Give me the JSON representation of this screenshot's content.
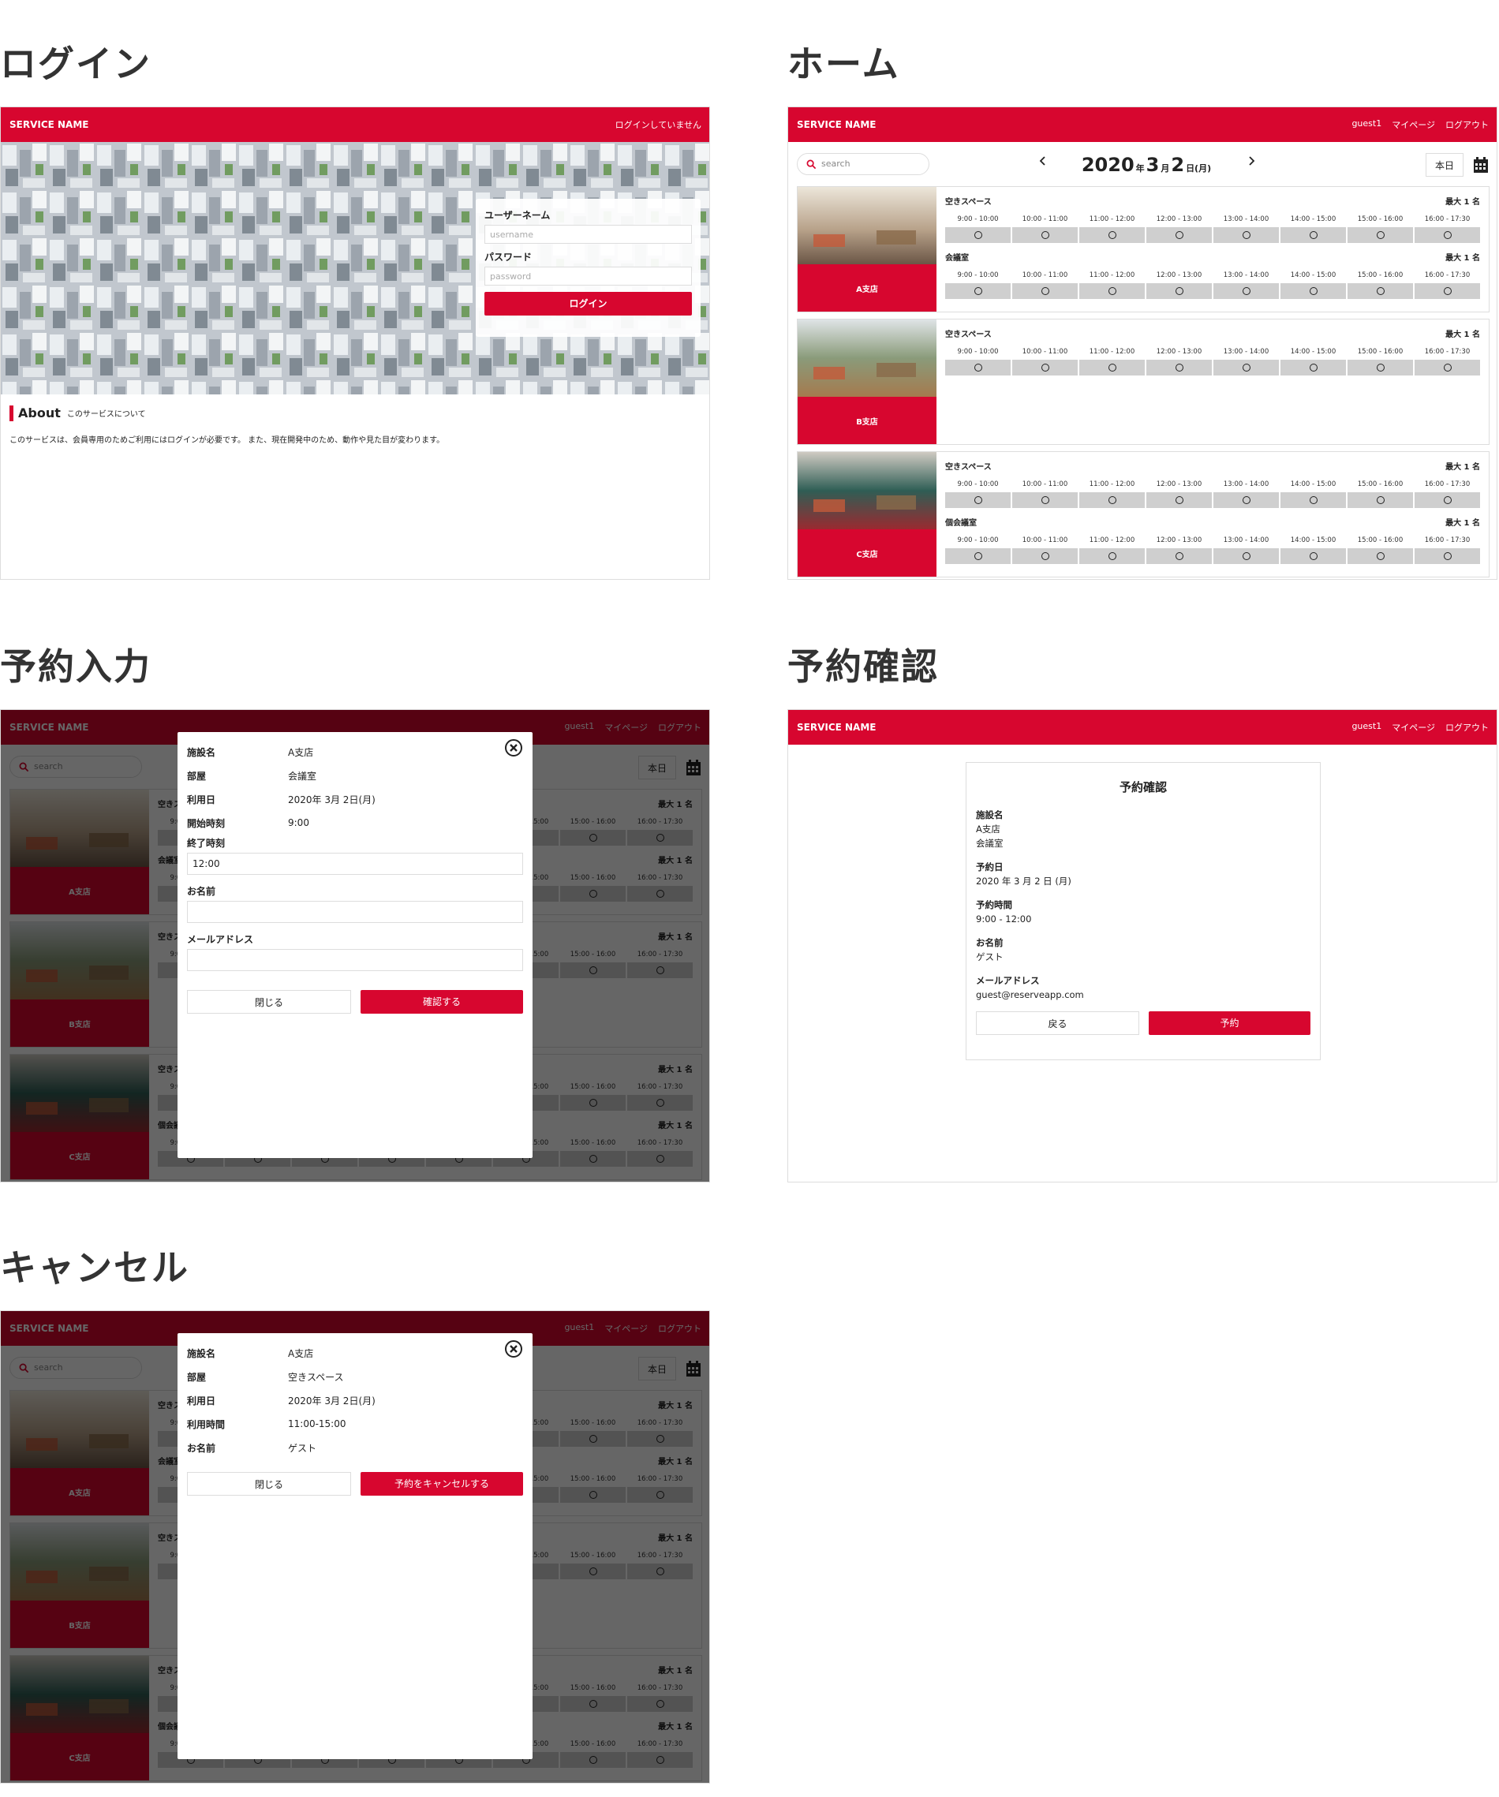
{
  "sections": {
    "login": "ログイン",
    "home": "ホーム",
    "reserve_input": "予約入力",
    "reserve_confirm": "予約確認",
    "cancel": "キャンセル"
  },
  "brand": "SERVICE NAME",
  "header_logged_out": "ログインしていません",
  "header_user": {
    "user": "guest1",
    "mypage": "マイページ",
    "logout": "ログアウト"
  },
  "login": {
    "username_label": "ユーザーネーム",
    "username_placeholder": "username",
    "password_label": "パスワード",
    "password_placeholder": "password",
    "button": "ログイン",
    "about_heading": "About",
    "about_sub": "このサービスについて",
    "about_text": "このサービスは、会員専用のためご利用にはログインが必要です。 また、現在開発中のため、動作や見た目が変わります。"
  },
  "home": {
    "search_placeholder": "search",
    "year": "2020",
    "year_unit": "年",
    "month": "3",
    "month_unit": "月",
    "day": "2",
    "day_unit": "日(月)",
    "today": "本日",
    "slot_times": [
      "9:00 - 10:00",
      "10:00 - 11:00",
      "11:00 - 12:00",
      "12:00 - 13:00",
      "13:00 - 14:00",
      "14:00 - 15:00",
      "15:00 - 16:00",
      "16:00 - 17:30"
    ],
    "available_mark": "○",
    "branches": [
      {
        "name": "A支店",
        "rooms": [
          {
            "name": "空きスペース",
            "cap": "最大 1 名"
          },
          {
            "name": "会議室",
            "cap": "最大 1 名"
          }
        ]
      },
      {
        "name": "B支店",
        "rooms": [
          {
            "name": "空きスペース",
            "cap": "最大 1 名"
          }
        ]
      },
      {
        "name": "C支店",
        "rooms": [
          {
            "name": "空きスペース",
            "cap": "最大 1 名"
          },
          {
            "name": "個会議室",
            "cap": "最大 1 名"
          }
        ]
      }
    ]
  },
  "reserve_modal": {
    "facility_label": "施設名",
    "facility": "A支店",
    "room_label": "部屋",
    "room": "会議室",
    "date_label": "利用日",
    "date": "2020年 3月 2日(月)",
    "start_label": "開始時刻",
    "start": "9:00",
    "end_label": "終了時刻",
    "end": "12:00",
    "name_label": "お名前",
    "email_label": "メールアドレス",
    "close": "閉じる",
    "confirm": "確認する"
  },
  "confirm_page": {
    "title": "予約確認",
    "facility_label": "施設名",
    "facility": "A支店",
    "room": "会議室",
    "date_label": "予約日",
    "date": "2020 年 3 月 2 日 (月)",
    "time_label": "予約時間",
    "time": "9:00 - 12:00",
    "name_label": "お名前",
    "name": "ゲスト",
    "email_label": "メールアドレス",
    "email": "guest@reserveapp.com",
    "back": "戻る",
    "reserve": "予約"
  },
  "cancel_modal": {
    "facility_label": "施設名",
    "facility": "A支店",
    "room_label": "部屋",
    "room": "空きスペース",
    "date_label": "利用日",
    "date": "2020年 3月 2日(月)",
    "time_label": "利用時間",
    "time": "11:00-15:00",
    "name_label": "お名前",
    "name": "ゲスト",
    "close": "閉じる",
    "cancel": "予約をキャンセルする"
  },
  "colors": {
    "brand_red": "#d7062f",
    "slot_gray": "#cfcfcf"
  }
}
